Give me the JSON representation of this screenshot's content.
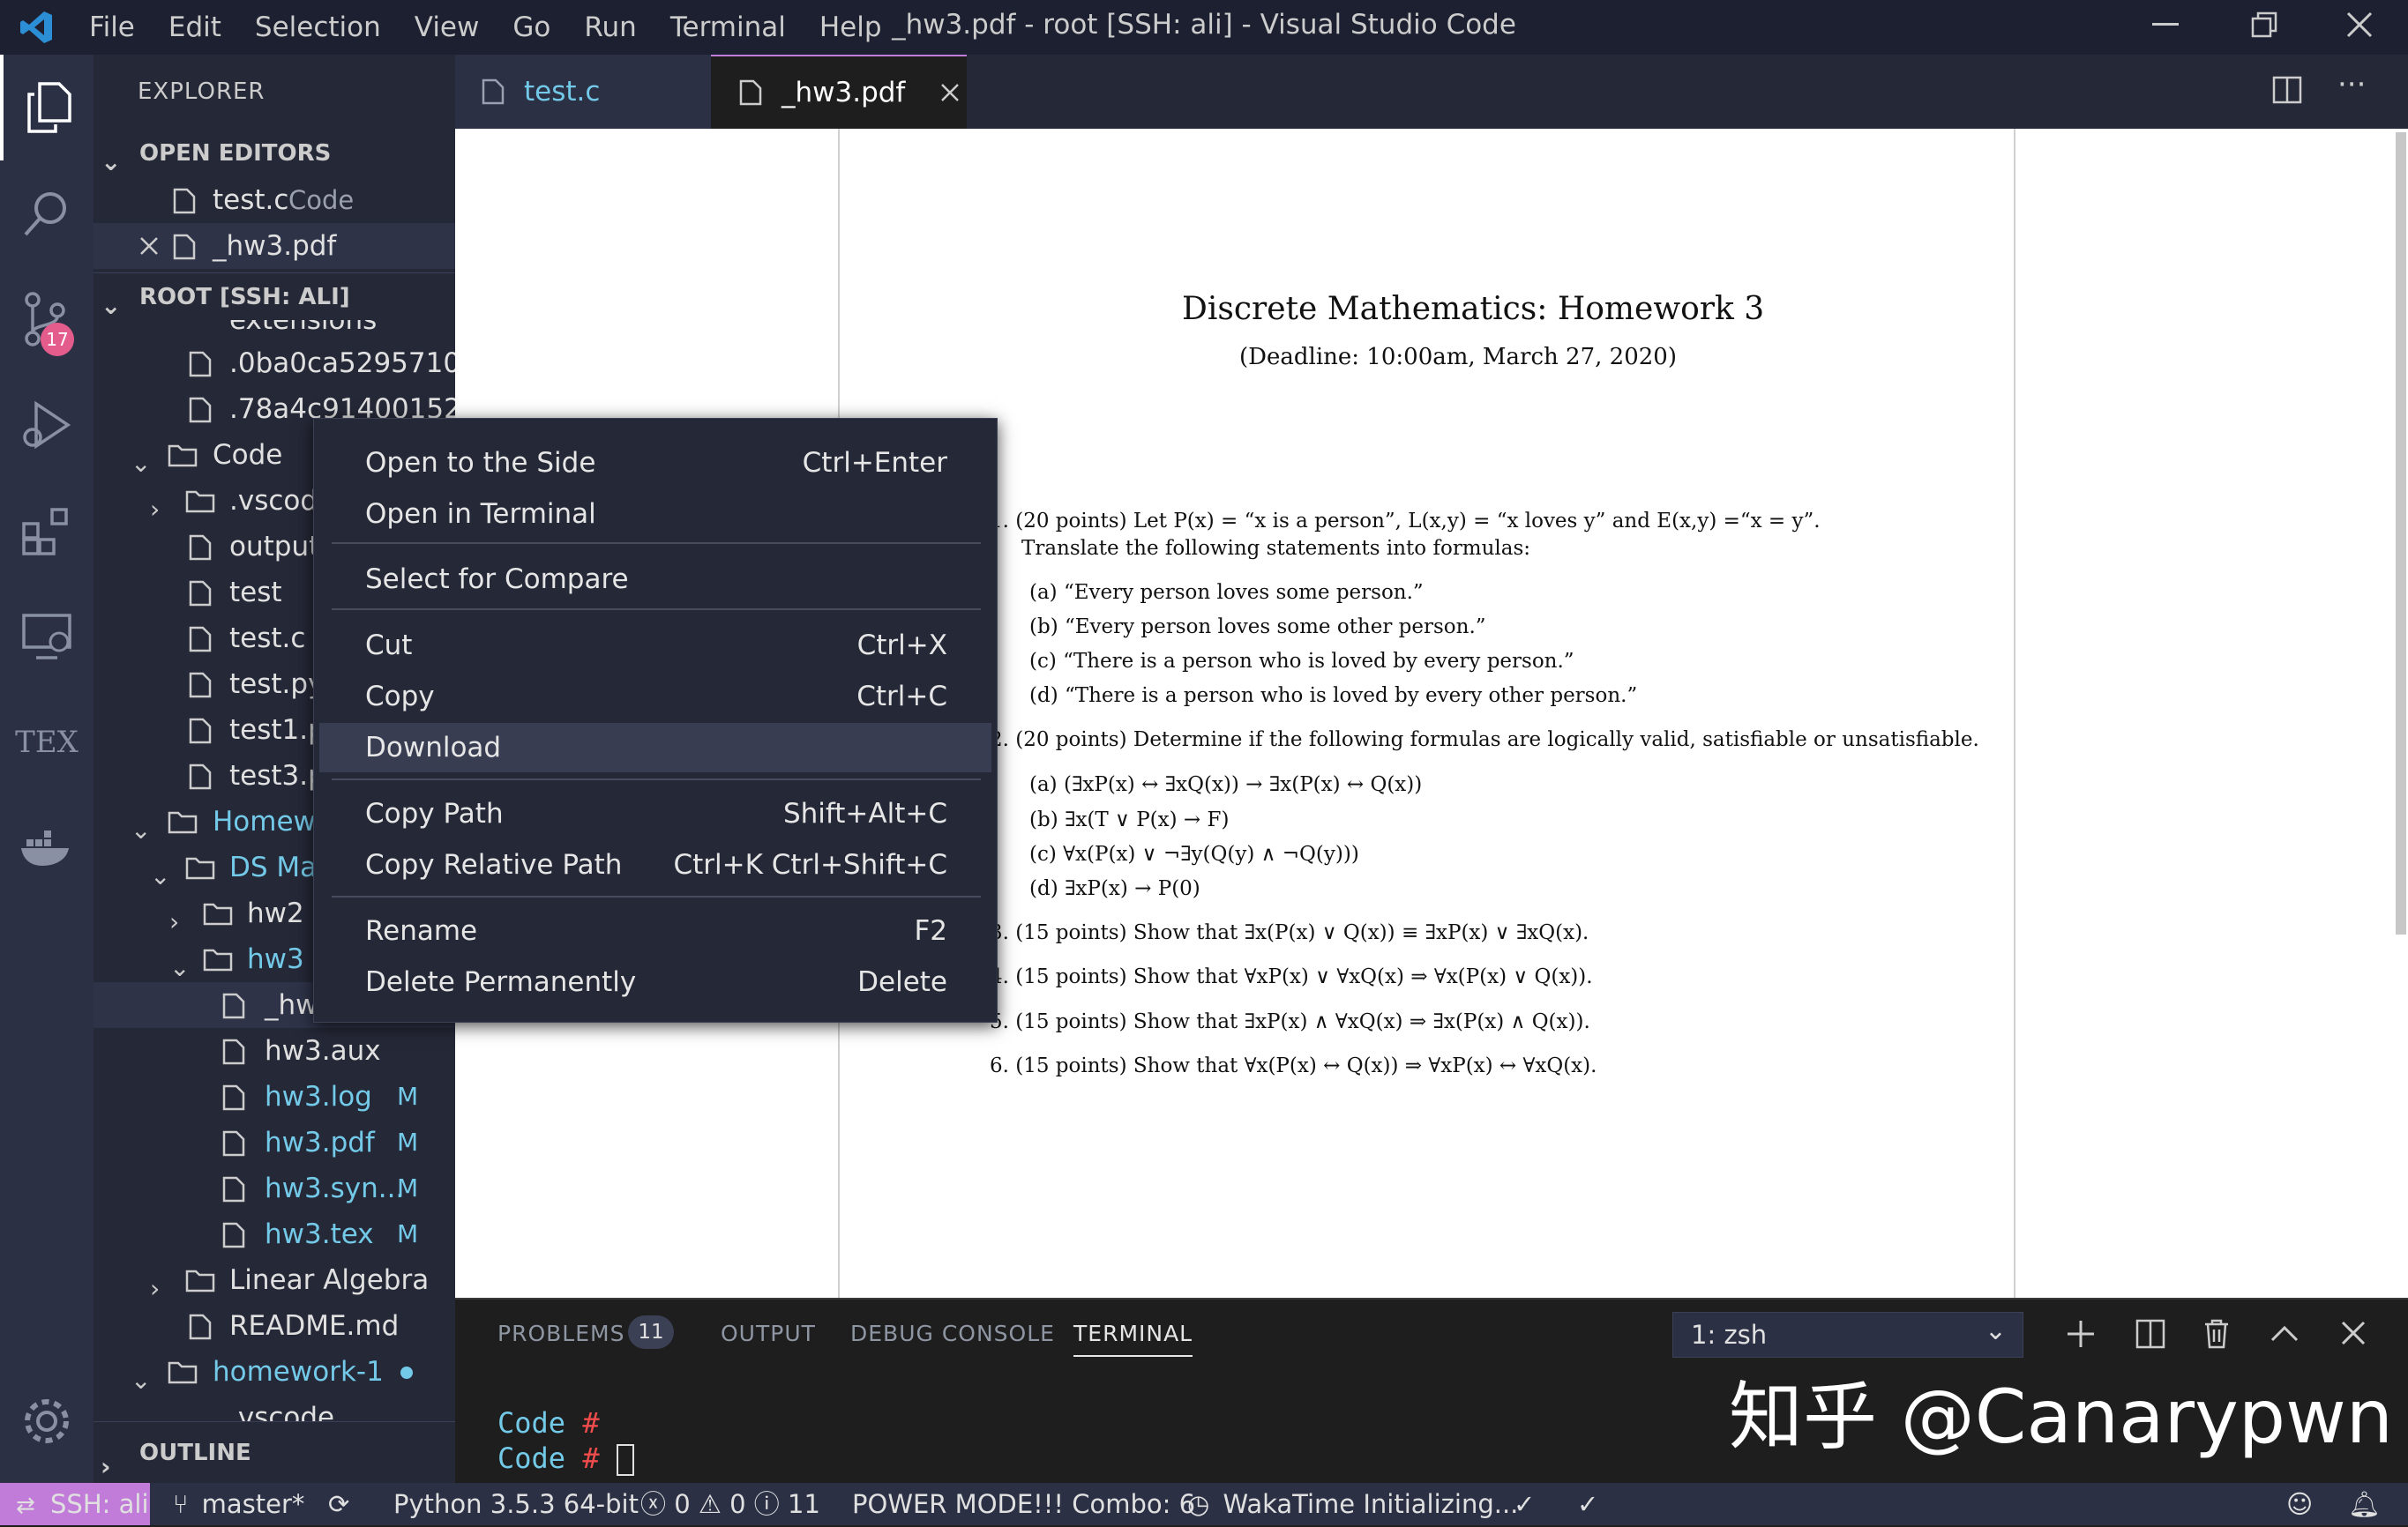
{
  "window": {
    "title": "_hw3.pdf - root [SSH: ali] - Visual Studio Code",
    "menu": [
      "File",
      "Edit",
      "Selection",
      "View",
      "Go",
      "Run",
      "Terminal",
      "Help"
    ]
  },
  "activitybar": {
    "scm_badge": "17",
    "tex_label": "TEX"
  },
  "sidebar": {
    "title": "EXPLORER",
    "open_editors": {
      "label": "OPEN EDITORS",
      "items": [
        {
          "name": "test.c",
          "desc": "Code"
        },
        {
          "name": "_hw3.pdf",
          "desc": ""
        }
      ]
    },
    "root": {
      "label": "ROOT [SSH: ALI]",
      "items": [
        {
          "name": "extensions"
        },
        {
          "name": ".0ba0ca5295710..."
        },
        {
          "name": ".78a4c91400152..."
        },
        {
          "name": "Code"
        },
        {
          "name": ".vscode"
        },
        {
          "name": "output"
        },
        {
          "name": "test"
        },
        {
          "name": "test.c"
        },
        {
          "name": "test.py"
        },
        {
          "name": "test1.p"
        },
        {
          "name": "test3.p"
        },
        {
          "name": "Homework"
        },
        {
          "name": "DS Ma"
        },
        {
          "name": "hw2"
        },
        {
          "name": "hw3"
        },
        {
          "name": "_hw3.pdf"
        },
        {
          "name": "hw3.aux"
        },
        {
          "name": "hw3.log",
          "badge": "M"
        },
        {
          "name": "hw3.pdf",
          "badge": "M"
        },
        {
          "name": "hw3.syn...",
          "badge": "M"
        },
        {
          "name": "hw3.tex",
          "badge": "M"
        },
        {
          "name": "Linear Algebra"
        },
        {
          "name": "README.md"
        },
        {
          "name": "homework-1"
        },
        {
          "name": ".vscode"
        }
      ]
    },
    "outline": "OUTLINE"
  },
  "tabs": [
    {
      "label": "test.c"
    },
    {
      "label": "_hw3.pdf"
    }
  ],
  "pdf": {
    "title": "Discrete Mathematics: Homework 3",
    "deadline": "(Deadline: 10:00am, March 27, 2020)",
    "q1": "1.  (20 points) Let P(x) = “x is a person”, L(x,y) = “x loves y” and E(x,y) =“x = y”.",
    "q1b": "Translate the following statements into formulas:",
    "q1_items": [
      "(a)  “Every person loves some person.”",
      "(b)  “Every person loves some other person.”",
      "(c)  “There is a person who is loved by every person.”",
      "(d)  “There is a person who is loved by every other person.”"
    ],
    "q2": "2.  (20 points) Determine if the following formulas are logically valid, satisfiable or unsatisfiable.",
    "q2_items": [
      "(a)  (∃xP(x) ↔ ∃xQ(x)) → ∃x(P(x) ↔ Q(x))",
      "(b)  ∃x(T ∨ P(x) → F)",
      "(c)  ∀x(P(x) ∨ ¬∃y(Q(y) ∧ ¬Q(y)))",
      "(d)  ∃xP(x) → P(0)"
    ],
    "q3": "3.  (15 points) Show that ∃x(P(x) ∨ Q(x)) ≡ ∃xP(x) ∨ ∃xQ(x).",
    "q4": "4.  (15 points) Show that ∀xP(x) ∨ ∀xQ(x) ⇒ ∀x(P(x) ∨ Q(x)).",
    "q5": "5.  (15 points) Show that ∃xP(x) ∧ ∀xQ(x) ⇒ ∃x(P(x) ∧ Q(x)).",
    "q6": "6.  (15 points) Show that ∀x(P(x) ↔ Q(x)) ⇒ ∀xP(x) ↔ ∀xQ(x)."
  },
  "context_menu": {
    "items": [
      {
        "label": "Open to the Side",
        "shortcut": "Ctrl+Enter"
      },
      {
        "label": "Open in Terminal",
        "shortcut": ""
      },
      {
        "label": "Select for Compare",
        "shortcut": ""
      },
      {
        "label": "Cut",
        "shortcut": "Ctrl+X"
      },
      {
        "label": "Copy",
        "shortcut": "Ctrl+C"
      },
      {
        "label": "Download",
        "shortcut": ""
      },
      {
        "label": "Copy Path",
        "shortcut": "Shift+Alt+C"
      },
      {
        "label": "Copy Relative Path",
        "shortcut": "Ctrl+K Ctrl+Shift+C"
      },
      {
        "label": "Rename",
        "shortcut": "F2"
      },
      {
        "label": "Delete Permanently",
        "shortcut": "Delete"
      }
    ]
  },
  "panel": {
    "tabs": [
      "PROBLEMS",
      "OUTPUT",
      "DEBUG CONSOLE",
      "TERMINAL"
    ],
    "problems_count": "11",
    "terminal_select": "1: zsh",
    "lines": [
      {
        "dir": "Code",
        "prompt": "#"
      },
      {
        "dir": "Code",
        "prompt": "#"
      }
    ]
  },
  "statusbar": {
    "remote": "SSH: ali",
    "branch": "master*",
    "python": "Python 3.5.3 64-bit",
    "errors": "0",
    "warnings": "0",
    "infos": "11",
    "power": "POWER MODE!!! Combo: 6",
    "wakatime": "WakaTime Initializing..."
  },
  "watermark": "知乎 @Canarypwn",
  "colors": {
    "accent": "#c17bd8",
    "link": "#73c9e8",
    "terminal_prompt": "#f14c4c",
    "badge": "#e35c8c"
  }
}
